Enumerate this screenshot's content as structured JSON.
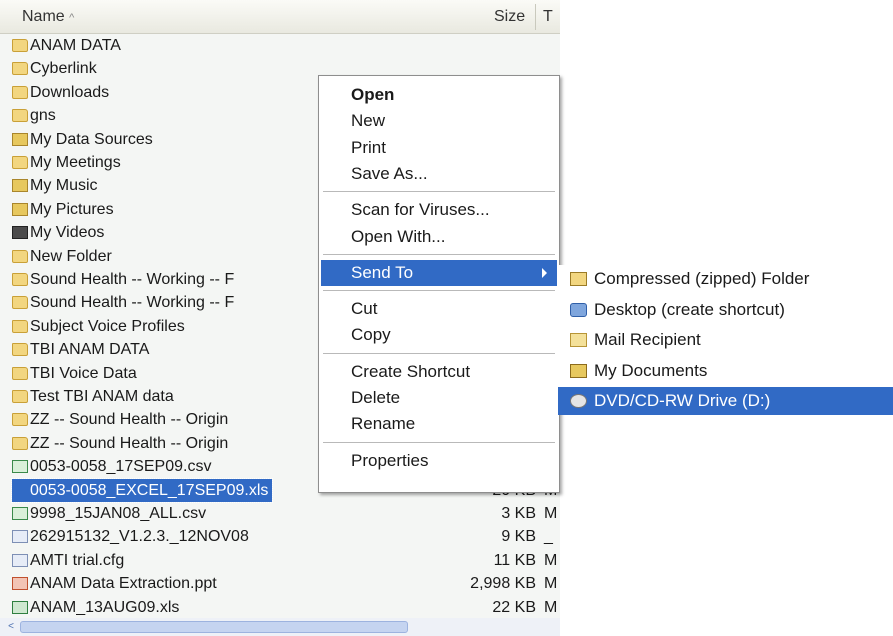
{
  "header": {
    "name": "Name",
    "sort_glyph": "^",
    "size": "Size",
    "type": "T"
  },
  "files": [
    {
      "name": "ANAM DATA",
      "icon": "folder-icon",
      "kind": "folder",
      "size": "",
      "type": ""
    },
    {
      "name": "Cyberlink",
      "icon": "folder-icon",
      "kind": "folder",
      "size": "",
      "type": ""
    },
    {
      "name": "Downloads",
      "icon": "folder-icon",
      "kind": "folder",
      "size": "",
      "type": ""
    },
    {
      "name": "gns",
      "icon": "folder-icon",
      "kind": "folder",
      "size": "",
      "type": ""
    },
    {
      "name": "My Data Sources",
      "icon": "data-sources-folder-icon",
      "kind": "special",
      "size": "",
      "type": ""
    },
    {
      "name": "My Meetings",
      "icon": "folder-icon",
      "kind": "folder",
      "size": "",
      "type": ""
    },
    {
      "name": "My Music",
      "icon": "music-folder-icon",
      "kind": "special",
      "size": "",
      "type": ""
    },
    {
      "name": "My Pictures",
      "icon": "pictures-folder-icon",
      "kind": "special",
      "size": "",
      "type": ""
    },
    {
      "name": "My Videos",
      "icon": "videos-folder-icon",
      "kind": "video",
      "size": "",
      "type": ""
    },
    {
      "name": "New Folder",
      "icon": "folder-icon",
      "kind": "folder",
      "size": "",
      "type": ""
    },
    {
      "name": "Sound Health  --  Working  --  F",
      "icon": "folder-icon",
      "kind": "folder",
      "size": "",
      "type": ""
    },
    {
      "name": "Sound Health  --  Working  --  F",
      "icon": "folder-icon",
      "kind": "folder",
      "size": "",
      "type": ""
    },
    {
      "name": "Subject Voice Profiles",
      "icon": "folder-icon",
      "kind": "folder",
      "size": "",
      "type": ""
    },
    {
      "name": "TBI ANAM DATA",
      "icon": "folder-icon",
      "kind": "folder",
      "size": "",
      "type": ""
    },
    {
      "name": "TBI Voice  Data",
      "icon": "folder-icon",
      "kind": "folder",
      "size": "",
      "type": ""
    },
    {
      "name": "Test TBI ANAM data",
      "icon": "folder-icon",
      "kind": "folder",
      "size": "",
      "type": ""
    },
    {
      "name": "ZZ  --  Sound Health  --  Origin",
      "icon": "folder-icon",
      "kind": "folder",
      "size": "",
      "type": ""
    },
    {
      "name": "ZZ  --  Sound Health  --  Origin",
      "icon": "folder-icon",
      "kind": "folder",
      "size": "",
      "type": ""
    },
    {
      "name": "0053-0058_17SEP09.csv",
      "icon": "csv-file-icon",
      "kind": "csv",
      "size": "",
      "type": ""
    },
    {
      "name": "0053-0058_EXCEL_17SEP09.xls",
      "icon": "excel-file-icon",
      "kind": "xls",
      "size": "20 KB",
      "type": "M",
      "selected": true
    },
    {
      "name": "9998_15JAN08_ALL.csv",
      "icon": "csv-file-icon",
      "kind": "csv",
      "size": "3 KB",
      "type": "M"
    },
    {
      "name": "262915132_V1.2.3._12NOV08",
      "icon": "generic-file-icon",
      "kind": "cfg",
      "size": "9 KB",
      "type": "_"
    },
    {
      "name": "AMTI trial.cfg",
      "icon": "config-file-icon",
      "kind": "cfg",
      "size": "11 KB",
      "type": "M"
    },
    {
      "name": "ANAM Data Extraction.ppt",
      "icon": "powerpoint-file-icon",
      "kind": "ppt",
      "size": "2,998 KB",
      "type": "M"
    },
    {
      "name": "ANAM_13AUG09.xls",
      "icon": "excel-file-icon",
      "kind": "xls",
      "size": "22 KB",
      "type": "M"
    }
  ],
  "scrollbar": {
    "left_arrow": "<"
  },
  "context_menu": {
    "items": [
      {
        "label": "Open",
        "bold": true
      },
      {
        "label": "New"
      },
      {
        "label": "Print"
      },
      {
        "label": "Save As..."
      },
      {
        "separator": true
      },
      {
        "label": "Scan for Viruses..."
      },
      {
        "label": "Open With..."
      },
      {
        "separator": true
      },
      {
        "label": "Send To",
        "highlighted": true,
        "submenu": true
      },
      {
        "separator": true
      },
      {
        "label": "Cut"
      },
      {
        "label": "Copy"
      },
      {
        "separator": true
      },
      {
        "label": "Create Shortcut"
      },
      {
        "label": "Delete"
      },
      {
        "label": "Rename"
      },
      {
        "separator": true
      },
      {
        "label": "Properties"
      }
    ]
  },
  "send_to": {
    "items": [
      {
        "label": "Compressed (zipped) Folder",
        "icon": "zip-folder-icon",
        "kind": "zip"
      },
      {
        "label": "Desktop (create shortcut)",
        "icon": "desktop-icon",
        "kind": "desk"
      },
      {
        "label": "Mail Recipient",
        "icon": "mail-icon",
        "kind": "mail"
      },
      {
        "label": "My Documents",
        "icon": "my-documents-icon",
        "kind": "docs"
      },
      {
        "label": "DVD/CD-RW Drive (D:)",
        "icon": "dvd-drive-icon",
        "kind": "dvd",
        "highlighted": true
      }
    ]
  },
  "colors": {
    "selection": "#316ac5",
    "pane_bg": "#f4f6f4",
    "menu_bg": "#ffffff"
  }
}
